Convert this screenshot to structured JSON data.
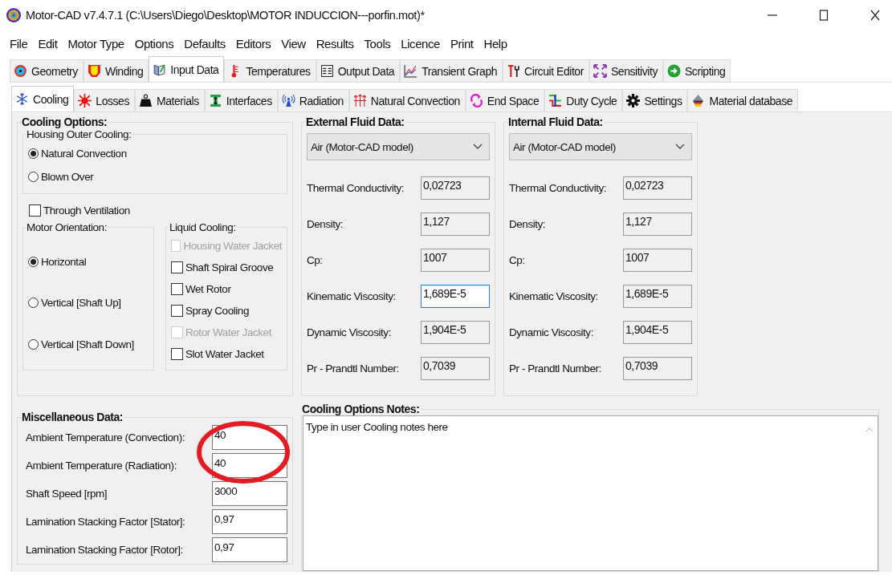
{
  "window": {
    "title": "Motor-CAD v7.4.7.1 (C:\\Users\\Diego\\Desktop\\MOTOR INDUCCION---porfin.mot)*"
  },
  "menu": [
    "File",
    "Edit",
    "Motor Type",
    "Options",
    "Defaults",
    "Editors",
    "View",
    "Results",
    "Tools",
    "Licence",
    "Print",
    "Help"
  ],
  "main_tabs": [
    {
      "label": "Geometry",
      "selected": false
    },
    {
      "label": "Winding",
      "selected": false
    },
    {
      "label": "Input Data",
      "selected": true
    },
    {
      "label": "Temperatures",
      "selected": false
    },
    {
      "label": "Output Data",
      "selected": false
    },
    {
      "label": "Transient Graph",
      "selected": false
    },
    {
      "label": "Circuit Editor",
      "selected": false
    },
    {
      "label": "Sensitivity",
      "selected": false
    },
    {
      "label": "Scripting",
      "selected": false
    }
  ],
  "sub_tabs": [
    {
      "label": "Cooling",
      "selected": true
    },
    {
      "label": "Losses",
      "selected": false
    },
    {
      "label": "Materials",
      "selected": false
    },
    {
      "label": "Interfaces",
      "selected": false
    },
    {
      "label": "Radiation",
      "selected": false
    },
    {
      "label": "Natural Convection",
      "selected": false
    },
    {
      "label": "End Space",
      "selected": false
    },
    {
      "label": "Duty Cycle",
      "selected": false
    },
    {
      "label": "Settings",
      "selected": false
    },
    {
      "label": "Material database",
      "selected": false
    }
  ],
  "cooling_options": {
    "title": "Cooling Options:",
    "housing_outer_cooling": {
      "title": "Housing Outer Cooling:",
      "options": [
        {
          "label": "Natural Convection",
          "selected": true
        },
        {
          "label": "Blown Over",
          "selected": false
        }
      ]
    },
    "through_ventilation": {
      "label": "Through Ventilation",
      "checked": false
    },
    "motor_orientation": {
      "title": "Motor Orientation:",
      "options": [
        {
          "label": "Horizontal",
          "selected": true
        },
        {
          "label": "Vertical [Shaft Up]",
          "selected": false
        },
        {
          "label": "Vertical [Shaft Down]",
          "selected": false
        }
      ]
    },
    "liquid_cooling": {
      "title": "Liquid Cooling:",
      "options": [
        {
          "label": "Housing Water Jacket",
          "checked": false,
          "disabled": true
        },
        {
          "label": "Shaft Spiral Groove",
          "checked": false,
          "disabled": false
        },
        {
          "label": "Wet Rotor",
          "checked": false,
          "disabled": false
        },
        {
          "label": "Spray Cooling",
          "checked": false,
          "disabled": false
        },
        {
          "label": "Rotor Water Jacket",
          "checked": false,
          "disabled": true
        },
        {
          "label": "Slot Water Jacket",
          "checked": false,
          "disabled": false
        }
      ]
    }
  },
  "fluid_panels": [
    {
      "title": "External Fluid Data:",
      "fluid": "Air (Motor-CAD model)",
      "fields": [
        {
          "label": "Thermal Conductivity:",
          "value": "0,02723",
          "focused": false
        },
        {
          "label": "Density:",
          "value": "1,127",
          "focused": false
        },
        {
          "label": "Cp:",
          "value": "1007",
          "focused": false
        },
        {
          "label": "Kinematic Viscosity:",
          "value": "1,689E-5",
          "focused": true
        },
        {
          "label": "Dynamic Viscosity:",
          "value": "1,904E-5",
          "focused": false
        },
        {
          "label": "Pr - Prandtl Number:",
          "value": "0,7039",
          "focused": false
        }
      ]
    },
    {
      "title": "Internal Fluid Data:",
      "fluid": "Air (Motor-CAD model)",
      "fields": [
        {
          "label": "Thermal Conductivity:",
          "value": "0,02723",
          "focused": false
        },
        {
          "label": "Density:",
          "value": "1,127",
          "focused": false
        },
        {
          "label": "Cp:",
          "value": "1007",
          "focused": false
        },
        {
          "label": "Kinematic Viscosity:",
          "value": "1,689E-5",
          "focused": false
        },
        {
          "label": "Dynamic Viscosity:",
          "value": "1,904E-5",
          "focused": false
        },
        {
          "label": "Pr - Prandtl Number:",
          "value": "0,7039",
          "focused": false
        }
      ]
    }
  ],
  "miscellaneous": {
    "title": "Miscellaneous Data:",
    "fields": [
      {
        "label": "Ambient Temperature (Convection):",
        "value": "40"
      },
      {
        "label": "Ambient Temperature (Radiation):",
        "value": "40"
      },
      {
        "label": "Shaft Speed [rpm]",
        "value": "3000"
      },
      {
        "label": "Lamination Stacking Factor [Stator]:",
        "value": "0,97"
      },
      {
        "label": "Lamination Stacking Factor [Rotor]:",
        "value": "0,97"
      }
    ]
  },
  "notes": {
    "title": "Cooling Options Notes:",
    "text": "Type in user Cooling notes here"
  }
}
